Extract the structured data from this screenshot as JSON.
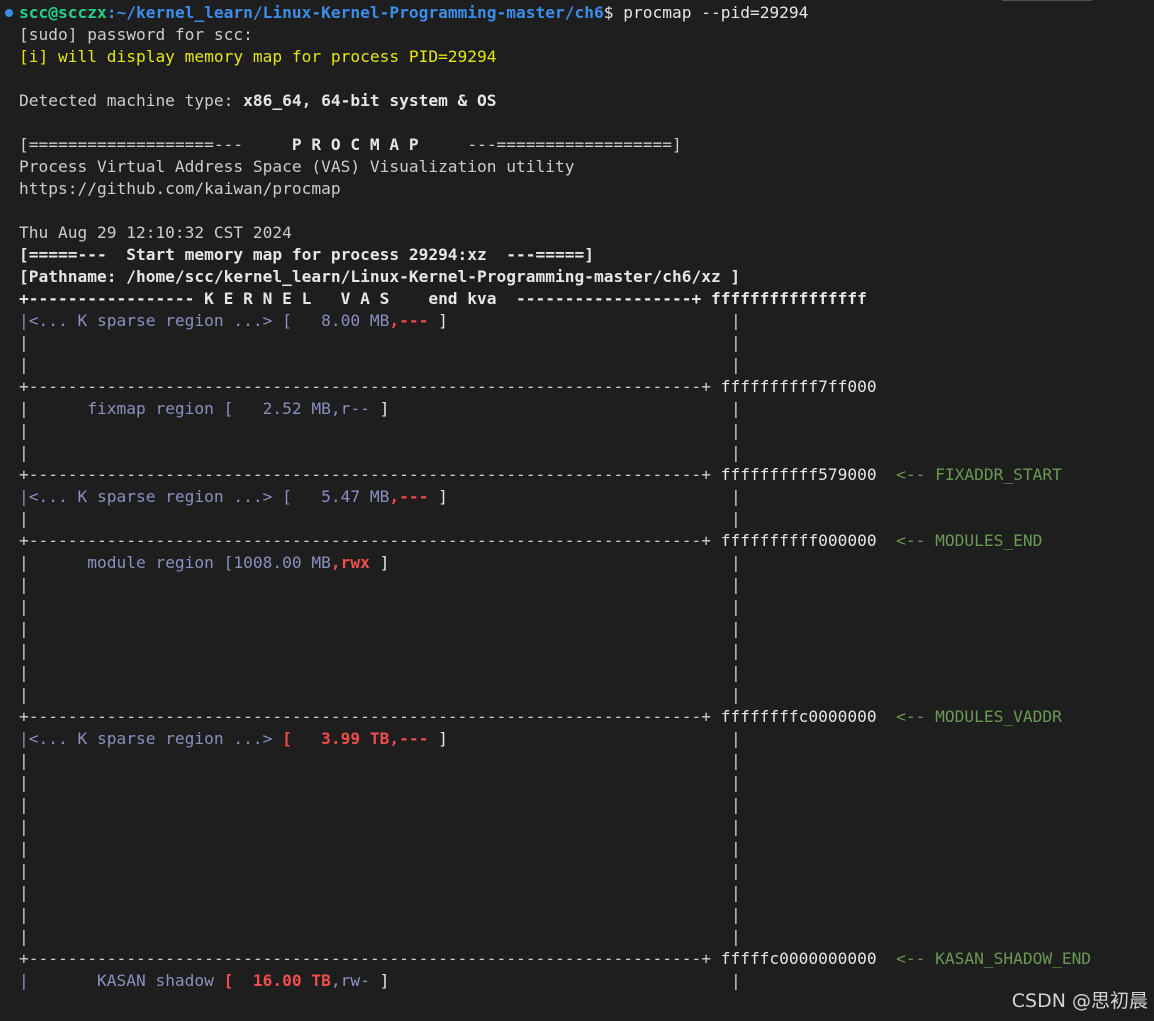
{
  "prompt": {
    "user_host": "scc@scczx",
    "path": ":~/kernel_learn/Linux-Kernel-Programming-master/ch6",
    "symbol": "$ ",
    "command": "procmap --pid=29294"
  },
  "output": {
    "sudo": "[sudo] password for scc:",
    "info": "[i] will display memory map for process PID=29294",
    "machine_label": "Detected machine type: ",
    "machine_value": "x86_64, 64-bit system & OS",
    "banner_left": "[===================---     ",
    "banner_title": "P R O C M A P",
    "banner_right": "     ---==================]",
    "desc": "Process Virtual Address Space (VAS) Visualization utility",
    "url": "https://github.com/kaiwan/procmap",
    "date": "Thu Aug 29 12:10:32 CST 2024",
    "start": "[=====---  Start memory map for process 29294:xz  ---=====]",
    "pathname": "[Pathname: /home/scc/kernel_learn/Linux-Kernel-Programming-master/ch6/xz ]"
  },
  "map": {
    "kernel_header": "+----------------- K E R N E L   V A S    end kva  ------------------+",
    "top_addr": "ffffffffffffffff",
    "separator": "+---------------------------------------------------------------------+",
    "bar": "|",
    "regions": {
      "r1": {
        "label": "<... K sparse region ...> [",
        "size": "   8.00 MB",
        "perm": ",---",
        "close": " ]",
        "addr": "ffffffffff7ff000",
        "marker": ""
      },
      "r2": {
        "label": "      fixmap region [",
        "size": "   2.52 MB",
        "perm": ",r--",
        "close": " ]",
        "addr": "ffffffffff579000",
        "marker": "<-- FIXADDR_START"
      },
      "r3": {
        "label": "<... K sparse region ...> [",
        "size": "   5.47 MB",
        "perm": ",---",
        "close": " ]",
        "addr": "ffffffffff000000",
        "marker": "<-- MODULES_END"
      },
      "r4": {
        "label": "      module region [",
        "size": "1008.00 MB",
        "perm": ",rwx",
        "close": " ]",
        "addr": "ffffffffc0000000",
        "marker": "<-- MODULES_VADDR"
      },
      "r5": {
        "label": "<... K sparse region ...> ",
        "open": "[",
        "size": "   3.99 TB",
        "perm": ",---",
        "close": " ]",
        "addr": "fffffc0000000000",
        "marker": "<-- KASAN_SHADOW_END"
      },
      "r6": {
        "label": "       KASAN shadow ",
        "open": "[",
        "size": "  16.00 TB",
        "perm": ",rw-",
        "close": " ]"
      }
    }
  },
  "watermark": "CSDN @思初晨"
}
